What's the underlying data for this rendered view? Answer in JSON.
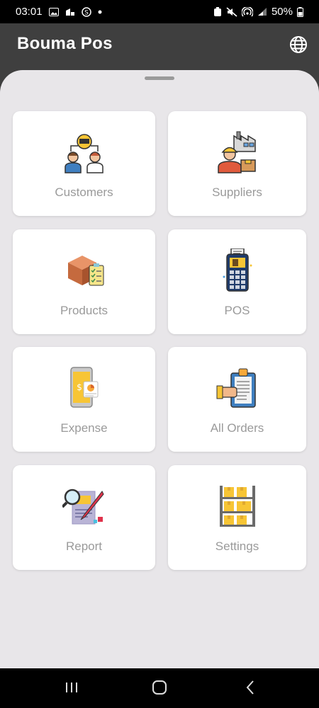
{
  "status_bar": {
    "time": "03:01",
    "battery": "50%"
  },
  "app_bar": {
    "title": "Bouma Pos",
    "language_icon": "globe-icon"
  },
  "menu": {
    "items": [
      {
        "label": "Customers",
        "icon": "customers-icon"
      },
      {
        "label": "Suppliers",
        "icon": "suppliers-icon"
      },
      {
        "label": "Products",
        "icon": "products-icon"
      },
      {
        "label": "POS",
        "icon": "pos-terminal-icon"
      },
      {
        "label": "Expense",
        "icon": "expense-icon"
      },
      {
        "label": "All Orders",
        "icon": "orders-clipboard-icon"
      },
      {
        "label": "Report",
        "icon": "report-icon"
      },
      {
        "label": "Settings",
        "icon": "warehouse-shelf-icon"
      }
    ]
  },
  "colors": {
    "app_bar": "#3f3f3f",
    "sheet": "#e8e6e9",
    "card": "#ffffff",
    "label": "#9a9a9a"
  }
}
